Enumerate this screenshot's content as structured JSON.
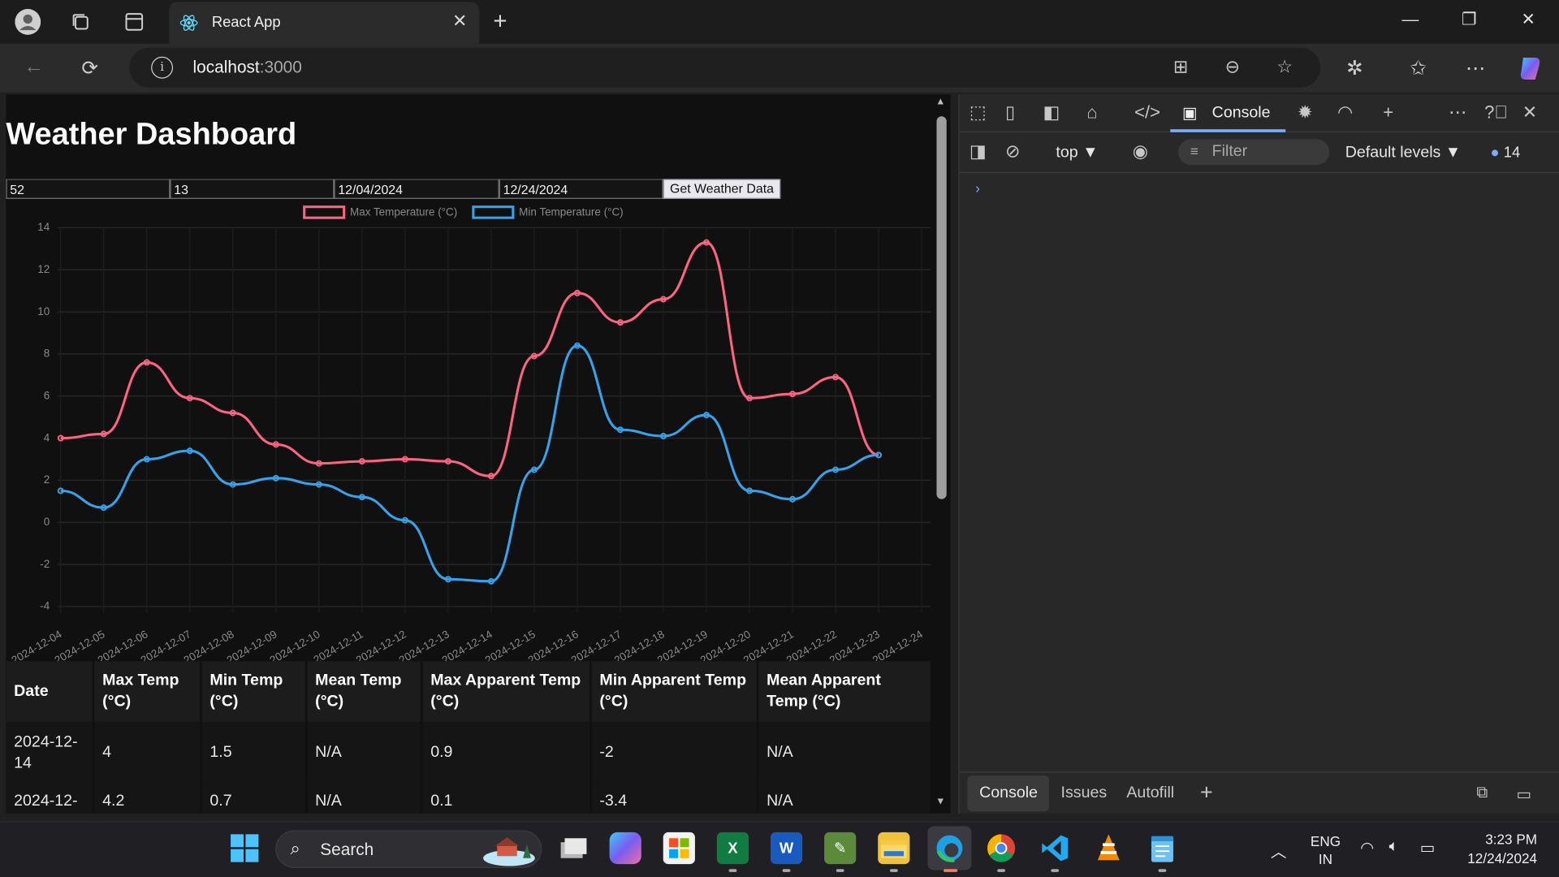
{
  "browser": {
    "tab_title": "React App",
    "url_host": "localhost",
    "url_port": ":3000"
  },
  "page": {
    "title": "Weather Dashboard",
    "form": {
      "lat_value": "52",
      "lon_value": "13",
      "start_date": "12/04/2024",
      "end_date": "12/24/2024",
      "submit_label": "Get Weather Data"
    },
    "table": {
      "headers": [
        "Date",
        "Max Temp (°C)",
        "Min Temp (°C)",
        "Mean Temp (°C)",
        "Max Apparent Temp (°C)",
        "Min Apparent Temp (°C)",
        "Mean Apparent Temp (°C)"
      ],
      "rows": [
        [
          "2024-12-14",
          "4",
          "1.5",
          "N/A",
          "0.9",
          "-2",
          "N/A"
        ],
        [
          "2024-12-",
          "4.2",
          "0.7",
          "N/A",
          "0.1",
          "-3.4",
          "N/A"
        ]
      ]
    }
  },
  "chart_data": {
    "type": "line",
    "title": "",
    "xlabel": "",
    "ylabel": "",
    "ylim": [
      -4,
      14
    ],
    "yticks": [
      -4,
      -2,
      0,
      2,
      4,
      6,
      8,
      10,
      12,
      14
    ],
    "legend_position": "top",
    "grid": true,
    "categories": [
      "2024-12-04",
      "2024-12-05",
      "2024-12-06",
      "2024-12-07",
      "2024-12-08",
      "2024-12-09",
      "2024-12-10",
      "2024-12-11",
      "2024-12-12",
      "2024-12-13",
      "2024-12-14",
      "2024-12-15",
      "2024-12-16",
      "2024-12-17",
      "2024-12-18",
      "2024-12-19",
      "2024-12-20",
      "2024-12-21",
      "2024-12-22",
      "2024-12-23",
      "2024-12-24"
    ],
    "series": [
      {
        "name": "Max Temperature (°C)",
        "color": "#ff6384",
        "values": [
          4.0,
          4.2,
          7.6,
          5.9,
          5.2,
          3.7,
          2.8,
          2.9,
          3.0,
          2.9,
          2.2,
          7.9,
          10.9,
          9.5,
          10.6,
          13.3,
          5.9,
          6.1,
          6.9,
          3.2
        ]
      },
      {
        "name": "Min Temperature (°C)",
        "color": "#36a2eb",
        "values": [
          1.5,
          0.7,
          3.0,
          3.4,
          1.8,
          2.1,
          1.8,
          1.2,
          0.1,
          -2.7,
          -2.8,
          2.5,
          8.4,
          4.4,
          4.1,
          5.1,
          1.5,
          1.1,
          2.5,
          3.2
        ]
      }
    ]
  },
  "devtools": {
    "active_tab": "Console",
    "context": "top",
    "filter_placeholder": "Filter",
    "levels": "Default levels",
    "issues_count": "14",
    "drawer_tabs": [
      "Console",
      "Issues",
      "Autofill"
    ]
  },
  "taskbar": {
    "search_label": "Search",
    "lang_line1": "ENG",
    "lang_line2": "IN",
    "time": "3:23 PM",
    "date": "12/24/2024"
  },
  "colors": {
    "accent": "#7cacf8",
    "max_series": "#ff6384",
    "min_series": "#36a2eb"
  }
}
